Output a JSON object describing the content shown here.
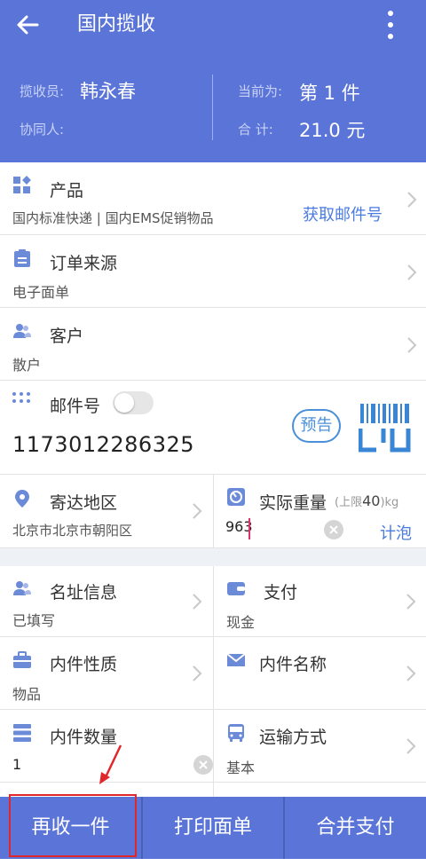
{
  "appbar": {
    "title": "国内揽收"
  },
  "info": {
    "collector_label": "揽收员:",
    "collector_name": "韩永春",
    "assistant_label": "协同人:",
    "current_label": "当前为:",
    "current_value": "第 1 件",
    "total_label": "合  计:",
    "total_value": "21.0 元"
  },
  "product": {
    "title": "产品",
    "value": "国内标准快递 | 国内EMS促销物品",
    "action": "获取邮件号"
  },
  "order_source": {
    "title": "订单来源",
    "value": "电子面单"
  },
  "customer": {
    "title": "客户",
    "value": "散户"
  },
  "mail_no": {
    "title": "邮件号",
    "value": "1173012286325",
    "presale_label": "预告",
    "toggle_on": false
  },
  "region": {
    "title": "寄达地区",
    "value": "北京市北京市朝阳区"
  },
  "weight": {
    "title": "实际重量",
    "limit_prefix": "(上限",
    "limit_value": "40",
    "limit_suffix": ")kg",
    "value": "963",
    "action": "计泡"
  },
  "address_info": {
    "title": "名址信息",
    "value": "已填写"
  },
  "payment": {
    "title": "支付",
    "value": "现金"
  },
  "content_type": {
    "title": "内件性质",
    "value": "物品"
  },
  "content_name": {
    "title": "内件名称",
    "value": ""
  },
  "content_qty": {
    "title": "内件数量",
    "value": "1"
  },
  "transport": {
    "title": "运输方式",
    "value": "基本"
  },
  "bottom": {
    "again_label": "再收一件",
    "print_label": "打印面单",
    "merge_pay_label": "合并支付"
  },
  "colors": {
    "primary": "#5b74d7",
    "link": "#4a7be0",
    "highlight": "#e0282c"
  }
}
